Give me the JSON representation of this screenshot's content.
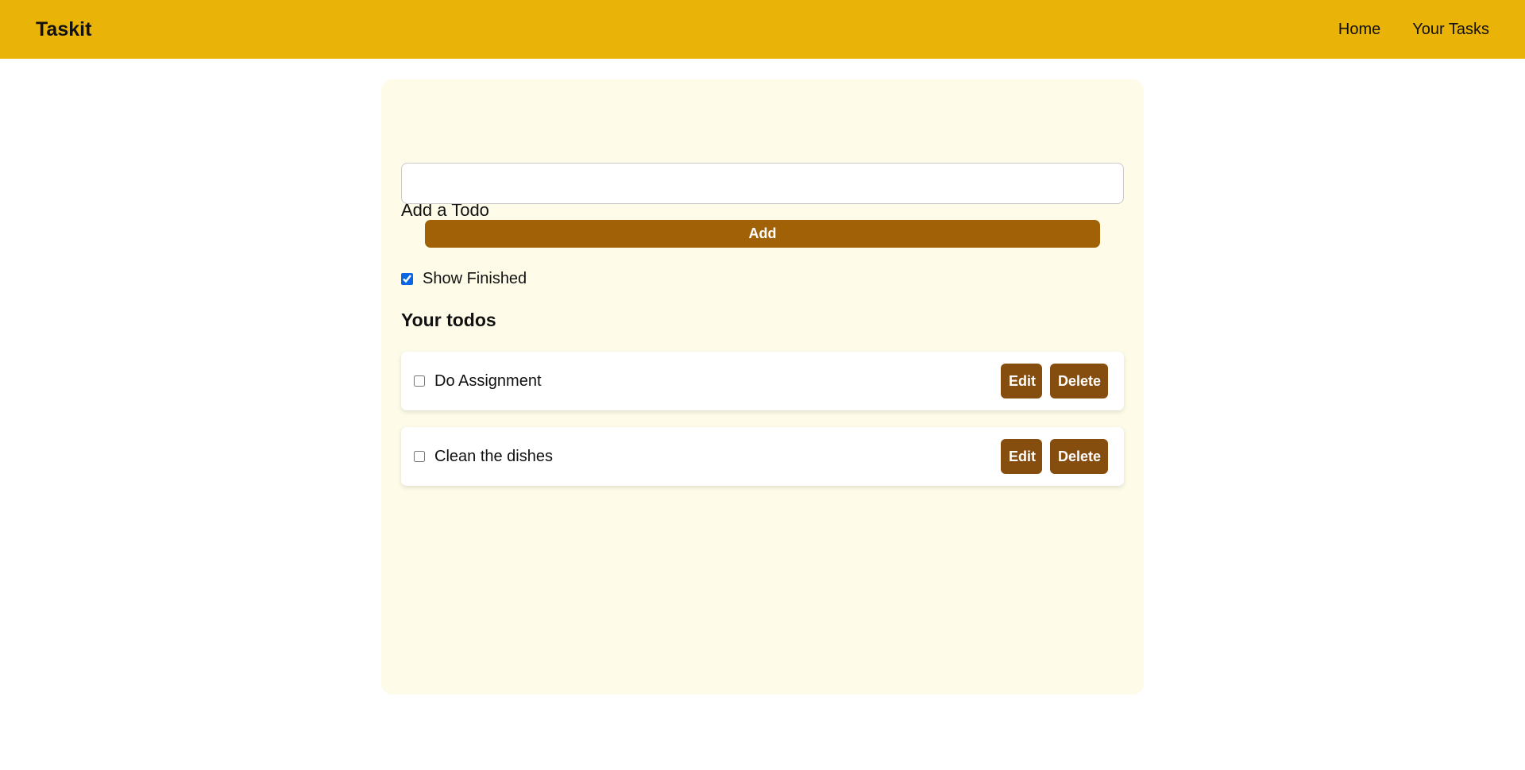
{
  "navbar": {
    "brand": "Taskit",
    "links": [
      "Home",
      "Your Tasks"
    ]
  },
  "add_form": {
    "heading": "Add a Todo",
    "input_value": "",
    "input_placeholder": "",
    "add_label": "Add"
  },
  "filter": {
    "show_finished_label": "Show Finished",
    "show_finished_checked": true
  },
  "todos": {
    "heading": "Your todos",
    "items": [
      {
        "text": "Do Assignment",
        "done": false,
        "edit_label": "Edit",
        "delete_label": "Delete"
      },
      {
        "text": "Clean the dishes",
        "done": false,
        "edit_label": "Edit",
        "delete_label": "Delete"
      }
    ]
  },
  "colors": {
    "navbar": "#eab308",
    "card": "#fefce8",
    "add_button": "#a16207",
    "row_button": "#854d0e"
  }
}
